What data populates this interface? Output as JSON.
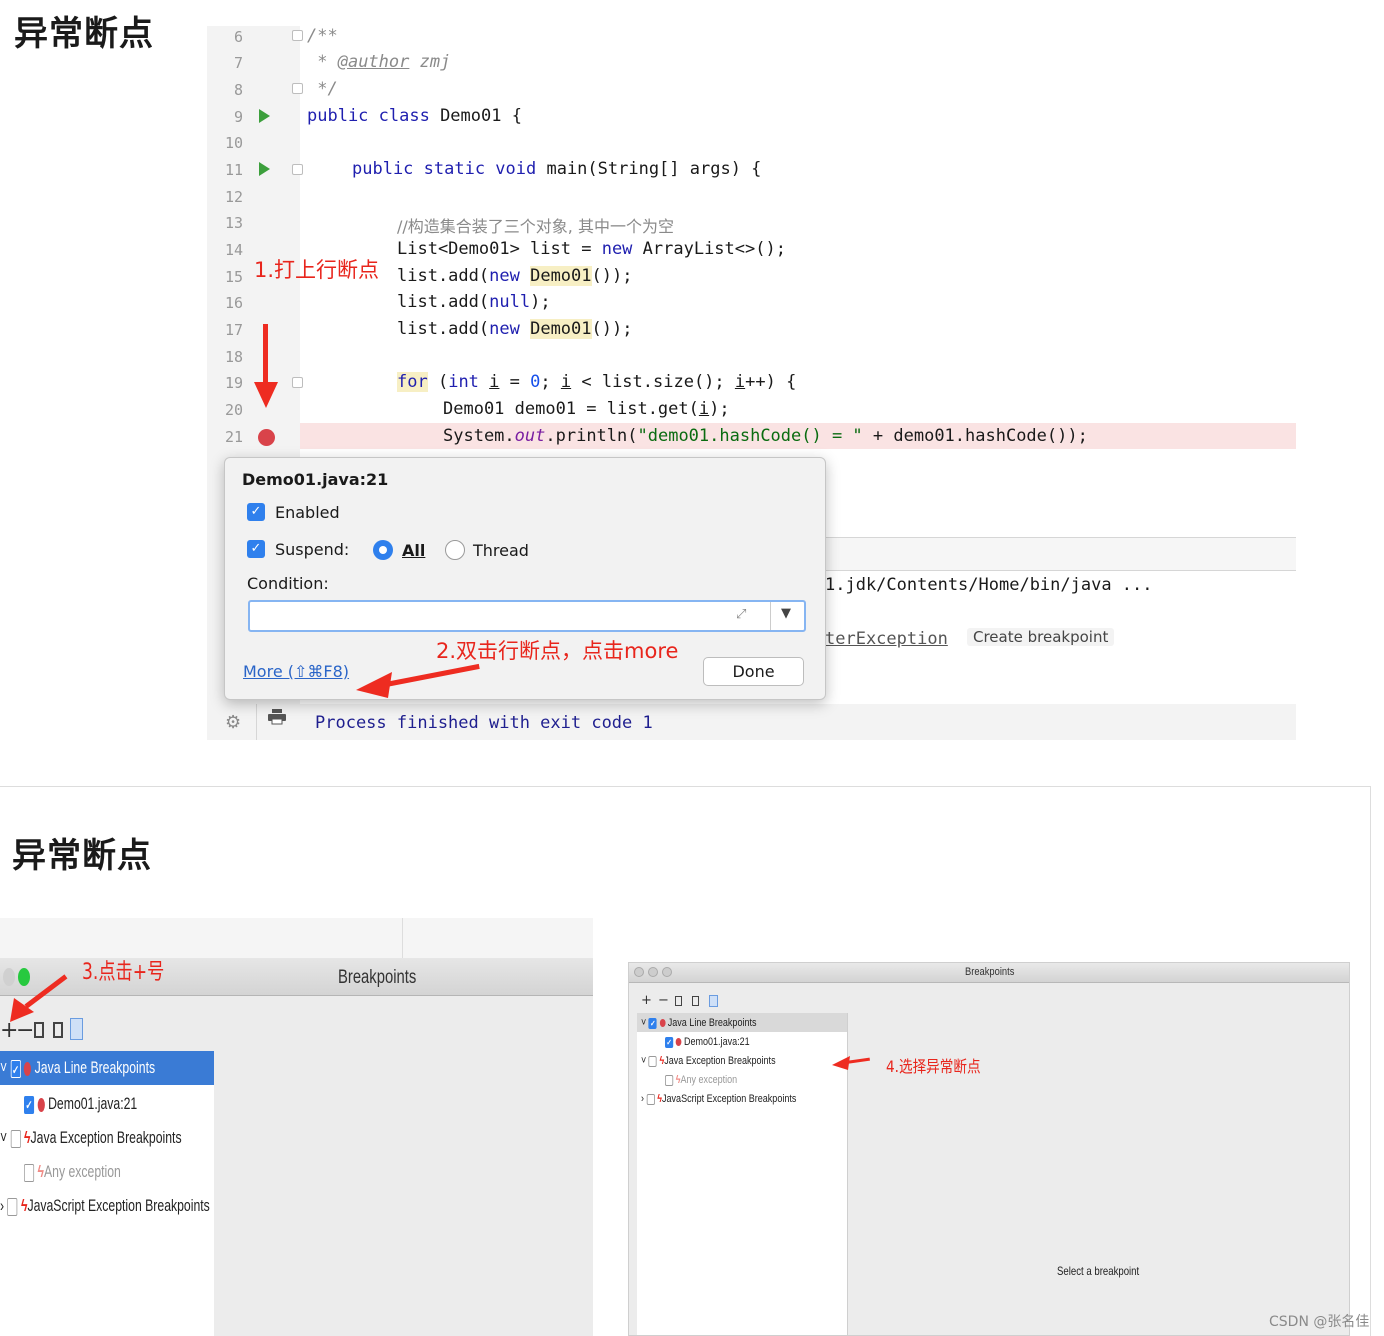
{
  "headings": {
    "top": "异常断点",
    "bottom": "异常断点"
  },
  "editor": {
    "line_numbers": [
      "6",
      "7",
      "8",
      "9",
      "10",
      "11",
      "12",
      "13",
      "14",
      "15",
      "16",
      "17",
      "18",
      "19",
      "20",
      "21"
    ],
    "code": {
      "l6": "/**",
      "l7_prefix": " * ",
      "l7_tag": "@author",
      "l7_rest": " zmj",
      "l8": " */",
      "l9_kw": "public class",
      "l9_rest": " Demo01 {",
      "l11_kw": "public static void",
      "l11_rest": " main(String[] args) {",
      "l13_comment": "//构造集合装了三个对象, 其中一个为空",
      "l14_a": "List<Demo01> list = ",
      "l14_new": "new",
      "l14_b": " ArrayList<>();",
      "l15_a": "list.add(",
      "l15_new": "new",
      "l15_cls": "Demo01",
      "l15_b": "());",
      "l16_a": "list.add(",
      "l16_null": "null",
      "l16_b": ");",
      "l17_a": "list.add(",
      "l17_new": "new",
      "l17_cls": "Demo01",
      "l17_b": "());",
      "l19_for": "for",
      "l19_a": " (",
      "l19_int": "int",
      "l19_i1": "i",
      "l19_b": " = ",
      "l19_zero": "0",
      "l19_c": "; ",
      "l19_i2": "i",
      "l19_d": " < list.size(); ",
      "l19_i3": "i",
      "l19_e": "++) {",
      "l20_a": "Demo01 demo01 = list.get(",
      "l20_i": "i",
      "l20_b": ");",
      "l21_a": "System.",
      "l21_out": "out",
      "l21_b": ".println(",
      "l21_str": "\"demo01.hashCode() = \"",
      "l21_c": " + demo01.hashCode());"
    },
    "run_path": "1.jdk/Contents/Home/bin/java ...",
    "exception_fragment": "terException",
    "create_breakpoint": "Create breakpoint",
    "process_finished": "Process finished with exit code 1"
  },
  "popup": {
    "title": "Demo01.java:21",
    "enabled_label": "Enabled",
    "suspend_label": "Suspend:",
    "all_label": "All",
    "thread_label": "Thread",
    "condition_label": "Condition:",
    "condition_value": "",
    "more_link": "More (⇧⌘F8)",
    "done_button": "Done"
  },
  "annotations": {
    "step1": "1.打上行断点",
    "step2": "2.双击行断点，点击more",
    "step3": "3.点击+号",
    "step4": "4.选择异常断点"
  },
  "breakpoints_left": {
    "window_title": "Breakpoints",
    "toolbar": [
      "+",
      "−"
    ],
    "items": {
      "java_line": "Java Line Breakpoints",
      "demo": "Demo01.java:21",
      "java_exception": "Java Exception Breakpoints",
      "any": "Any exception",
      "js_exception": "JavaScript Exception Breakpoints"
    }
  },
  "breakpoints_right": {
    "window_title": "Breakpoints",
    "toolbar": [
      "+",
      "−"
    ],
    "items": {
      "java_line": "Java Line Breakpoints",
      "demo": "Demo01.java:21",
      "java_exception": "Java Exception Breakpoints",
      "any": "Any exception",
      "js_exception": "JavaScript Exception Breakpoints"
    },
    "empty_message": "Select a breakpoint"
  },
  "footer_credit": "CSDN @张名佳",
  "colors": {
    "accent": "#2f80ed",
    "annotation_red": "#e8251c",
    "breakpoint_red": "#d9434a",
    "selection": "#3a7bd5"
  }
}
